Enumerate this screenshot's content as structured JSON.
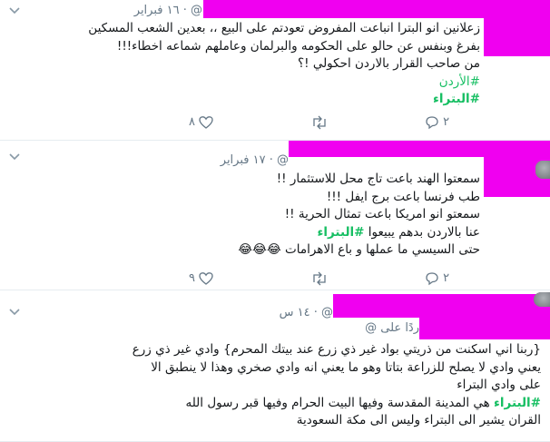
{
  "tweets": [
    {
      "date": "@ · ١٦ فبراير",
      "lines": [
        "زعلانين انو البترا انباعت المفروض تعودتم على البيع ،، بعدين الشعب المسكين",
        "بفرغ وبنفس عن حالو على الحكومه والبرلمان وعاملهم شماعه اخطاء!!!",
        "من صاحب القرار بالاردن احكولي !؟"
      ],
      "hashtags": [
        "#الأردن",
        "#البتراء"
      ],
      "actions": {
        "replies": "٢",
        "likes": "٨"
      }
    },
    {
      "date": "@ · ١٧ فبراير",
      "lines": [
        "سمعتوا الهند باعت تاج محل للاستثمار !!",
        "طب فرنسا باعت برج ايفل !!!",
        "سمعتو انو امريكا باعت تمثال الحرية !!",
        "عنا بالاردن بدهم يبيعوا",
        "حتى السيسي ما عملها و باع الاهرامات 😂😂😂"
      ],
      "inline_hashtag": "#البتراء",
      "actions": {
        "replies": "٢",
        "likes": "٩"
      }
    },
    {
      "date": "@ · ١٤ س",
      "reply_to": "ردًا على @",
      "lines": [
        "{ربنا اني اسكنت من ذريتي بواد غير ذي زرع عند بيتك المحرم} وادي غير ذي زرع",
        "يعني وادي لا يصلح للزراعة بتاتا وهو ما يعني انه وادي صخري وهذا لا ينطبق الا",
        "على وادي البتراء",
        "هي المدينة المقدسة وفيها البيت الحرام وفيها قبر رسول الله",
        "القران يشير الى البتراء وليس الى مكة السعودية"
      ],
      "inline_hashtag": "#البتراء"
    }
  ],
  "icons": {
    "reply": "reply-icon",
    "retweet": "retweet-icon",
    "like": "heart-icon",
    "caret": "chevron-down-icon"
  },
  "colors": {
    "hashtag": "#17bf63",
    "meta": "#657786",
    "redaction": "#f000f0",
    "divider": "#e6ecf0"
  }
}
